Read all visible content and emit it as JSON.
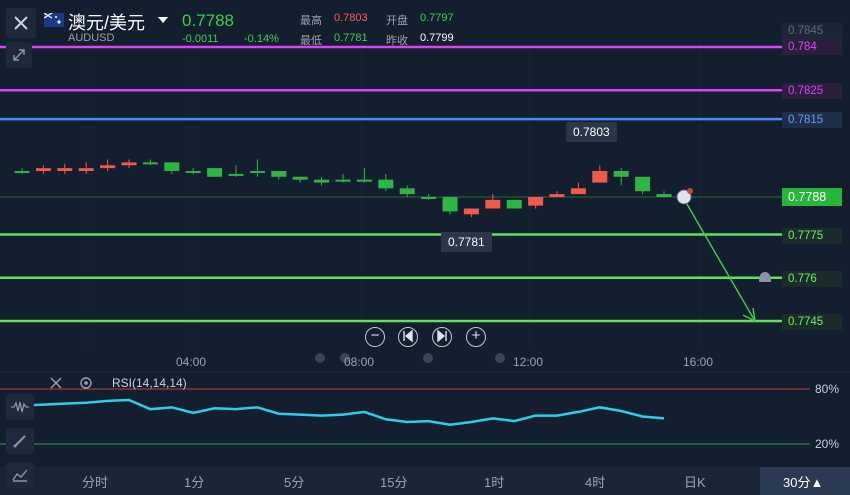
{
  "header": {
    "pair": "澳元/美元",
    "dropdown_icon": "caret-down-icon",
    "code": "AUDUSD",
    "price": "0.7788",
    "change": "-0.0011",
    "change_pct": "-0.14%",
    "high_label": "最高",
    "high": "0.7803",
    "open_label": "开盘",
    "open": "0.7797",
    "low_label": "最低",
    "low": "0.7781",
    "prev_close_label": "昨收",
    "prev_close": "0.7799"
  },
  "toolbar": {
    "close_icon": "close-icon",
    "fullscreen_icon": "collapse-icon"
  },
  "price_levels": [
    {
      "label": "0.7845",
      "color": "#5c6b80"
    },
    {
      "label": "0.784",
      "color": "#e040fb"
    },
    {
      "label": "0.7825",
      "color": "#e040fb"
    },
    {
      "label": "0.7815",
      "color": "#4d8cff"
    },
    {
      "label": "0.7788",
      "color": "#3ccf4e"
    },
    {
      "label": "0.7775",
      "color": "#5ee35a"
    },
    {
      "label": "0.776",
      "color": "#5ee35a"
    },
    {
      "label": "0.7745",
      "color": "#5ee35a"
    }
  ],
  "annotations": {
    "peak": "0.7803",
    "trough": "0.7781"
  },
  "controls": {
    "zoom_out": "−",
    "prev": "prev-icon",
    "next": "next-icon",
    "zoom_in": "+"
  },
  "time_labels": [
    "04:00",
    "08:00",
    "12:00",
    "16:00"
  ],
  "rsi": {
    "label": "RSI(14,14,14)",
    "upper": "80%",
    "lower": "20%",
    "values": [
      62,
      63,
      64,
      65,
      67,
      68,
      58,
      60,
      54,
      59,
      58,
      60,
      53,
      52,
      51,
      52,
      55,
      47,
      44,
      45,
      41,
      44,
      48,
      45,
      51,
      51,
      55,
      60,
      56,
      50,
      48
    ]
  },
  "chart_data": {
    "type": "candlestick",
    "pair": "AUDUSD",
    "x_tick_labels": [
      "04:00",
      "08:00",
      "12:00",
      "16:00"
    ],
    "candles": [
      {
        "o": 0.7797,
        "c": 0.7797,
        "h": 0.7798,
        "l": 0.7796
      },
      {
        "o": 0.7797,
        "c": 0.7798,
        "h": 0.7799,
        "l": 0.7796
      },
      {
        "o": 0.7797,
        "c": 0.7798,
        "h": 0.77995,
        "l": 0.7796
      },
      {
        "o": 0.7797,
        "c": 0.7798,
        "h": 0.78,
        "l": 0.7796
      },
      {
        "o": 0.7798,
        "c": 0.7799,
        "h": 0.7801,
        "l": 0.7797
      },
      {
        "o": 0.7799,
        "c": 0.78,
        "h": 0.7801,
        "l": 0.7798
      },
      {
        "o": 0.78,
        "c": 0.78,
        "h": 0.7801,
        "l": 0.7799
      },
      {
        "o": 0.78,
        "c": 0.7797,
        "h": 0.78,
        "l": 0.7796
      },
      {
        "o": 0.7797,
        "c": 0.7797,
        "h": 0.7798,
        "l": 0.7796
      },
      {
        "o": 0.7798,
        "c": 0.7795,
        "h": 0.7798,
        "l": 0.7795
      },
      {
        "o": 0.7796,
        "c": 0.7796,
        "h": 0.7799,
        "l": 0.7795
      },
      {
        "o": 0.7797,
        "c": 0.7797,
        "h": 0.7801,
        "l": 0.7795
      },
      {
        "o": 0.7797,
        "c": 0.7795,
        "h": 0.7797,
        "l": 0.7794
      },
      {
        "o": 0.7795,
        "c": 0.7794,
        "h": 0.7795,
        "l": 0.7793
      },
      {
        "o": 0.7794,
        "c": 0.7793,
        "h": 0.7795,
        "l": 0.7792
      },
      {
        "o": 0.7794,
        "c": 0.7794,
        "h": 0.7796,
        "l": 0.7793
      },
      {
        "o": 0.7794,
        "c": 0.7794,
        "h": 0.7798,
        "l": 0.7793
      },
      {
        "o": 0.7794,
        "c": 0.7791,
        "h": 0.7796,
        "l": 0.779
      },
      {
        "o": 0.7791,
        "c": 0.7789,
        "h": 0.7792,
        "l": 0.7788
      },
      {
        "o": 0.7788,
        "c": 0.7788,
        "h": 0.7789,
        "l": 0.7787
      },
      {
        "o": 0.7788,
        "c": 0.7783,
        "h": 0.7788,
        "l": 0.7782
      },
      {
        "o": 0.7782,
        "c": 0.7784,
        "h": 0.7784,
        "l": 0.7781
      },
      {
        "o": 0.7784,
        "c": 0.7787,
        "h": 0.7789,
        "l": 0.7784
      },
      {
        "o": 0.7787,
        "c": 0.7784,
        "h": 0.7787,
        "l": 0.7784
      },
      {
        "o": 0.7785,
        "c": 0.7788,
        "h": 0.7788,
        "l": 0.7784
      },
      {
        "o": 0.7788,
        "c": 0.7789,
        "h": 0.779,
        "l": 0.7788
      },
      {
        "o": 0.7789,
        "c": 0.7791,
        "h": 0.7793,
        "l": 0.7789
      },
      {
        "o": 0.7793,
        "c": 0.7797,
        "h": 0.7799,
        "l": 0.7793
      },
      {
        "o": 0.7797,
        "c": 0.7795,
        "h": 0.7798,
        "l": 0.7792
      },
      {
        "o": 0.7795,
        "c": 0.779,
        "h": 0.7795,
        "l": 0.7789
      },
      {
        "o": 0.7789,
        "c": 0.7788,
        "h": 0.779,
        "l": 0.7788
      }
    ],
    "horizontal_lines": [
      0.784,
      0.7825,
      0.7815,
      0.7775,
      0.776,
      0.7745
    ],
    "current_price": 0.7788,
    "projection": {
      "from": 0.7788,
      "to": 0.7745
    }
  },
  "timeframes": [
    "分时",
    "1分",
    "5分",
    "15分",
    "1时",
    "4时",
    "日K",
    "30分▲"
  ]
}
